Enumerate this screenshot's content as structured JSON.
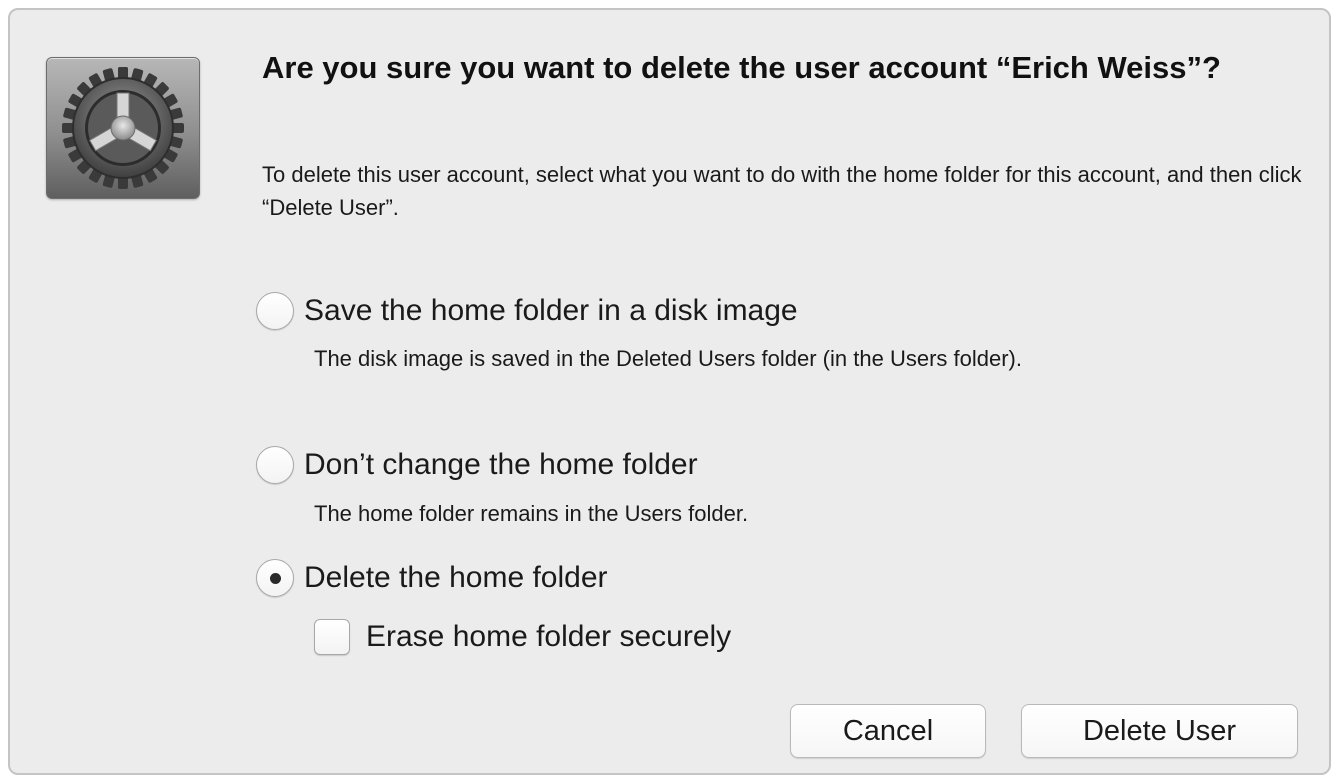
{
  "dialog": {
    "title": "Are you sure you want to delete the user account “Erich Weiss”?",
    "description": "To delete this user account, select what you want to do with the home folder for this account, and then click “Delete User”.",
    "icon": "system-preferences-gear-icon",
    "options": [
      {
        "label": "Save the home folder in a disk image",
        "help": "The disk image is saved in the Deleted Users folder (in the Users folder).",
        "selected": false
      },
      {
        "label": "Don’t change the home folder",
        "help": "The home folder remains in the Users folder.",
        "selected": false
      },
      {
        "label": "Delete the home folder",
        "help": "",
        "selected": true
      }
    ],
    "checkbox": {
      "label": "Erase home folder securely",
      "checked": false
    },
    "buttons": {
      "cancel": "Cancel",
      "delete": "Delete User"
    }
  }
}
